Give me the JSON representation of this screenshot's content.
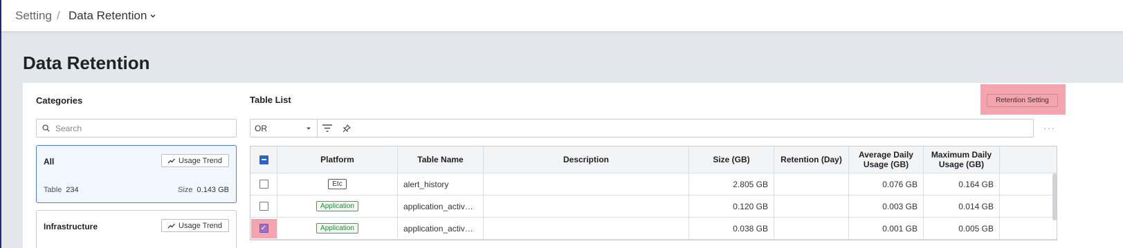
{
  "breadcrumb": {
    "root": "Setting",
    "separator": "/",
    "current": "Data Retention"
  },
  "page_title": "Data Retention",
  "categories": {
    "title": "Categories",
    "search_placeholder": "Search",
    "cards": [
      {
        "name": "All",
        "usage_label": "Usage Trend",
        "table_label": "Table",
        "table_count": "234",
        "size_label": "Size",
        "size_value": "0.143 GB"
      },
      {
        "name": "Infrastructure",
        "usage_label": "Usage Trend"
      }
    ]
  },
  "table_list": {
    "title": "Table List",
    "retention_button": "Retention Setting",
    "filter_operator": "OR",
    "more": "···",
    "columns": [
      "Platform",
      "Table Name",
      "Description",
      "Size (GB)",
      "Retention (Day)",
      "Average Daily Usage (GB)",
      "Maximum Daily Usage (GB)"
    ],
    "rows": [
      {
        "platform": "Etc",
        "table_name": "alert_history",
        "description": "",
        "size": "2.805 GB",
        "retention": "",
        "avg": "0.076 GB",
        "max": "0.164 GB"
      },
      {
        "platform": "Application",
        "table_name": "application_activ…",
        "description": "",
        "size": "0.120 GB",
        "retention": "",
        "avg": "0.003 GB",
        "max": "0.014 GB"
      },
      {
        "platform": "Application",
        "table_name": "application_activ…",
        "description": "",
        "size": "0.038 GB",
        "retention": "",
        "avg": "0.001 GB",
        "max": "0.005 GB"
      }
    ]
  },
  "colors": {
    "accent": "#1f66d8",
    "highlight": "#f5a3ad",
    "app_badge": "#3aa34b",
    "nav": "#1f2a7a"
  }
}
